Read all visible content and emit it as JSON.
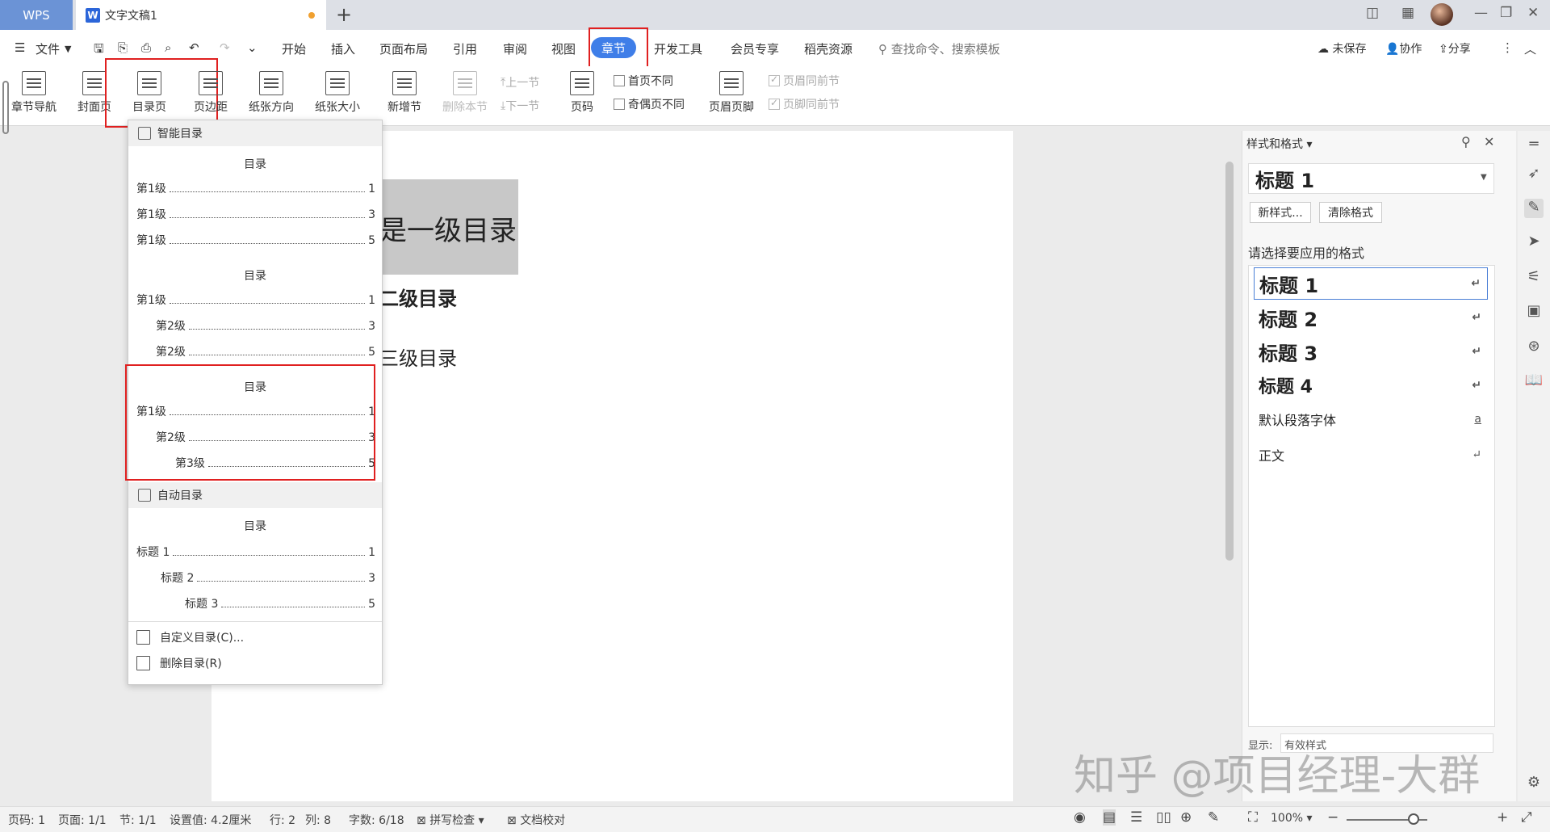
{
  "tabs": {
    "app": "WPS",
    "document": "文字文稿1",
    "doc_icon": "W"
  },
  "menu": {
    "file": "文件",
    "items": [
      "开始",
      "插入",
      "页面布局",
      "引用",
      "审阅",
      "视图",
      "章节",
      "开发工具",
      "会员专享",
      "稻壳资源"
    ],
    "search": "查找命令、搜索模板",
    "unsaved": "未保存",
    "collab": "协作",
    "share": "分享"
  },
  "ribbon": {
    "chapter_nav": "章节导航",
    "cover": "封面页",
    "toc": "目录页",
    "margin": "页边距",
    "orientation": "纸张方向",
    "size": "纸张大小",
    "new_section": "新增节",
    "delete_section": "删除本节",
    "prev_section": "上一节",
    "next_section": "下一节",
    "page_number": "页码",
    "first_diff": "首页不同",
    "odd_even_diff": "奇偶页不同",
    "header_footer": "页眉页脚",
    "same_header": "页眉同前节",
    "same_footer": "页脚同前节"
  },
  "document": {
    "h1": "是一级目录",
    "h2": "二级目录",
    "h3": "三级目录"
  },
  "toc_dropdown": {
    "smart_header": "智能目录",
    "auto_header": "自动目录",
    "toc_word": "目录",
    "smart1": [
      {
        "label": "第1级",
        "page": "1"
      },
      {
        "label": "第1级",
        "page": "3"
      },
      {
        "label": "第1级",
        "page": "5"
      }
    ],
    "smart2": [
      {
        "label": "第1级",
        "page": "1"
      },
      {
        "label": "第2级",
        "page": "3"
      },
      {
        "label": "第2级",
        "page": "5"
      }
    ],
    "smart3": [
      {
        "label": "第1级",
        "page": "1"
      },
      {
        "label": "第2级",
        "page": "3"
      },
      {
        "label": "第3级",
        "page": "5"
      }
    ],
    "auto": [
      {
        "label": "标题 1",
        "page": "1"
      },
      {
        "label": "标题 2",
        "page": "3"
      },
      {
        "label": "标题 3",
        "page": "5"
      }
    ],
    "custom": "自定义目录(C)...",
    "delete": "删除目录(R)"
  },
  "styles_panel": {
    "title": "样式和格式",
    "current": "标题  1",
    "new_style": "新样式...",
    "clear_format": "清除格式",
    "prompt": "请选择要应用的格式",
    "items": [
      {
        "label": "标题  1",
        "mark": "↵"
      },
      {
        "label": "标题  2",
        "mark": "↵"
      },
      {
        "label": "标题  3",
        "mark": "↵"
      },
      {
        "label": "标题  4",
        "mark": "↵"
      },
      {
        "label": "默认段落字体",
        "mark": "a"
      },
      {
        "label": "正文",
        "mark": "↵"
      }
    ],
    "display_label": "显示:",
    "display_value": "有效样式"
  },
  "status": {
    "page": "页码: 1",
    "pages": "页面: 1/1",
    "section": "节: 1/1",
    "setting": "设置值: 4.2厘米",
    "row": "行: 2",
    "col": "列: 8",
    "words": "字数: 6/18",
    "spell": "拼写检查",
    "proof": "文档校对",
    "zoom": "100%"
  },
  "watermark": "知乎 @项目经理-大群",
  "colors": {
    "accent": "#3f7ee8",
    "highlight_box": "#e02020",
    "wps_tab": "#6b93d6"
  }
}
